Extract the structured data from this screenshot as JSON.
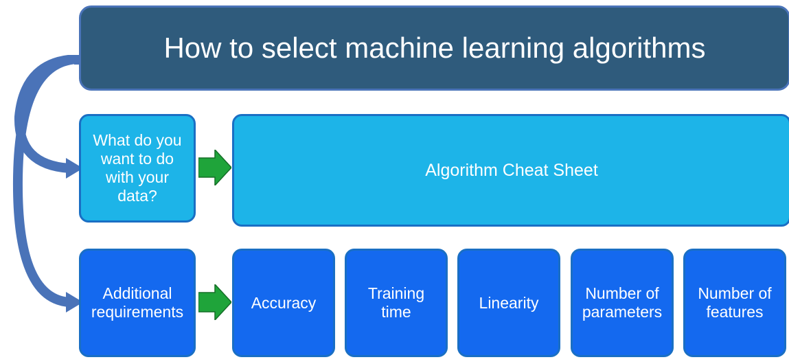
{
  "title": "How to select machine learning algorithms",
  "question": "What do you want to do with your data?",
  "cheat_sheet": "Algorithm Cheat Sheet",
  "additional": "Additional requirements",
  "criteria": [
    "Accuracy",
    "Training time",
    "Linearity",
    "Number of parameters",
    "Number of features"
  ]
}
